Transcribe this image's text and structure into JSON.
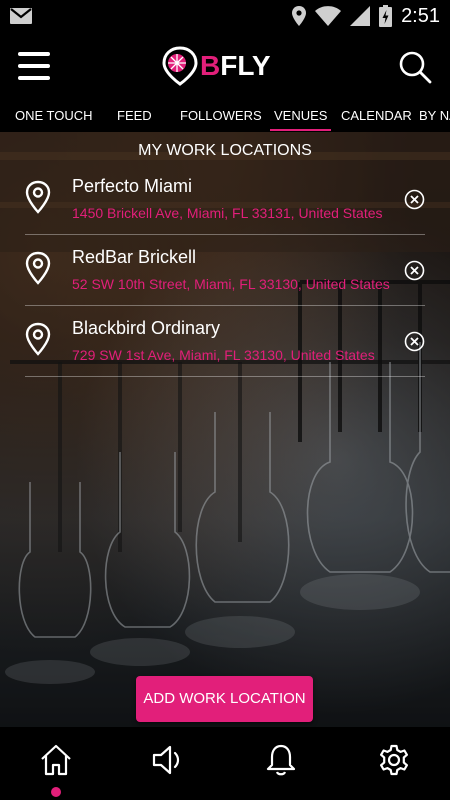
{
  "status_bar": {
    "time": "2:51",
    "icons": [
      "gmail-icon",
      "location-icon",
      "wifi-icon",
      "signal-icon",
      "battery-charging-icon"
    ]
  },
  "app": {
    "logo_letter": "B",
    "logo_rest": "FLY",
    "menu_icon": "hamburger-menu-icon",
    "search_icon": "search-icon"
  },
  "tabs": [
    {
      "label": "ONE TOUCH",
      "active": false
    },
    {
      "label": "FEED",
      "active": false
    },
    {
      "label": "FOLLOWERS",
      "active": false
    },
    {
      "label": "VENUES",
      "active": true
    },
    {
      "label": "CALENDAR",
      "active": false
    },
    {
      "label": "BY NA",
      "active": false
    }
  ],
  "section_title": "MY WORK LOCATIONS",
  "locations": [
    {
      "name": "Perfecto Miami",
      "address": "1450 Brickell Ave, Miami, FL 33131, United States"
    },
    {
      "name": "RedBar Brickell",
      "address": "52 SW 10th Street, Miami, FL 33130, United States"
    },
    {
      "name": "Blackbird Ordinary",
      "address": "729 SW 1st Ave, Miami, FL 33130, United States"
    }
  ],
  "add_button_label": "ADD WORK LOCATION",
  "bottom_nav": [
    {
      "icon": "home-icon",
      "active": true
    },
    {
      "icon": "speaker-icon",
      "active": false
    },
    {
      "icon": "bell-icon",
      "active": false
    },
    {
      "icon": "gear-icon",
      "active": false
    }
  ],
  "colors": {
    "accent": "#e21f7a",
    "background": "#000000",
    "text": "#ffffff"
  }
}
